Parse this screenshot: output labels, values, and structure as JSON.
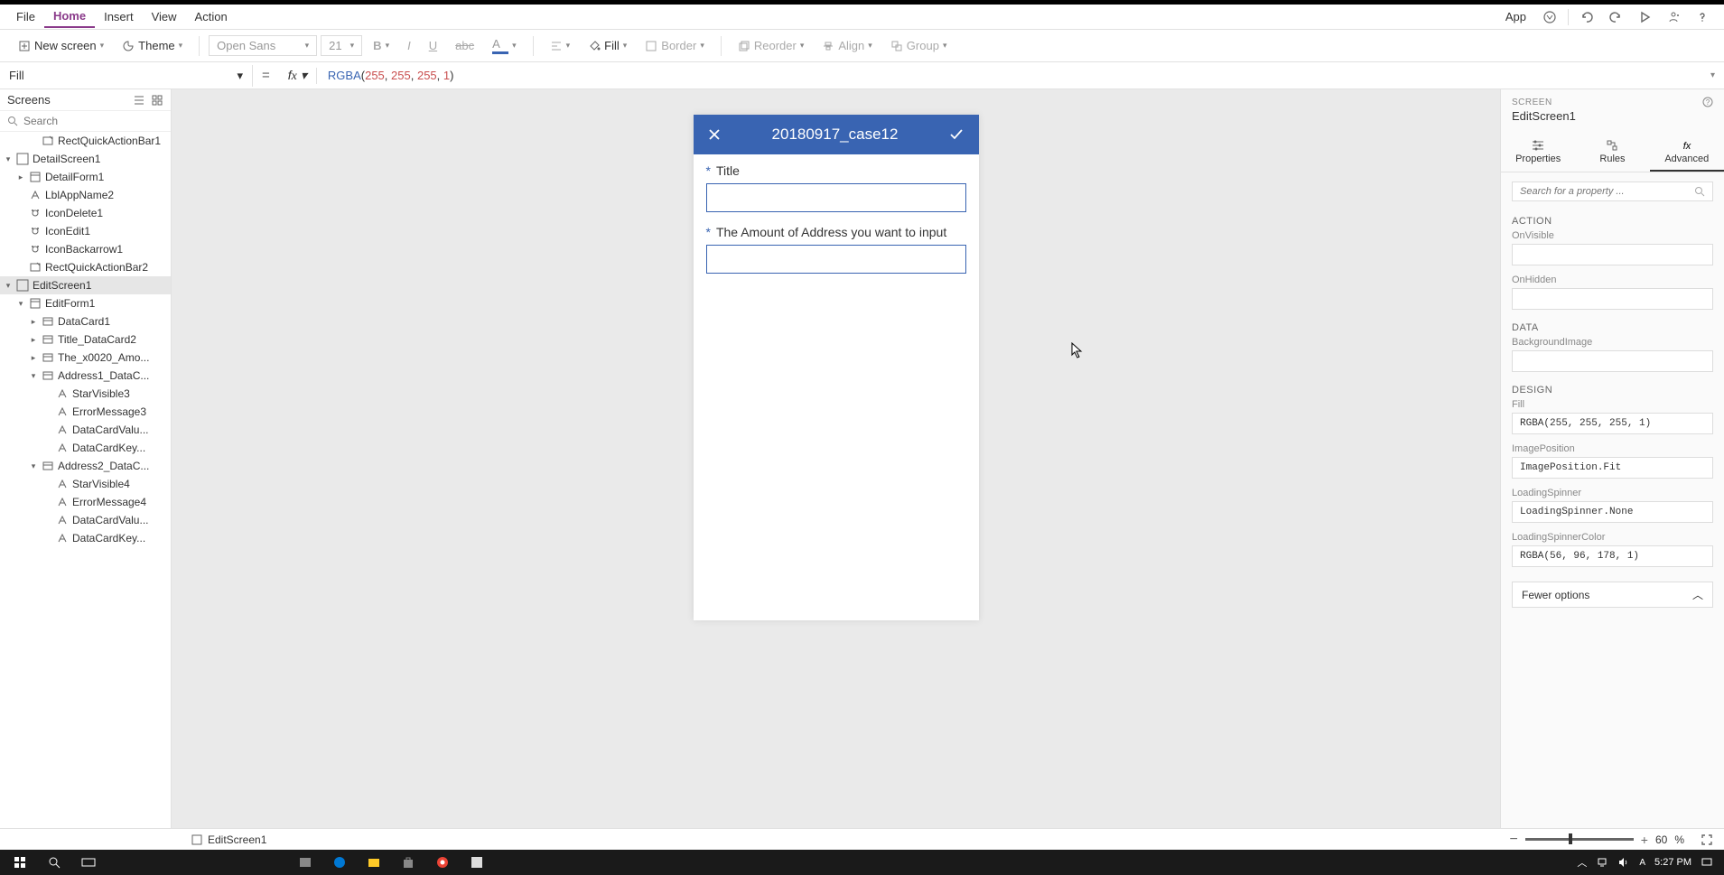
{
  "menubar": {
    "items": [
      "File",
      "Home",
      "Insert",
      "View",
      "Action"
    ],
    "active_index": 1,
    "app_label": "App"
  },
  "toolbar": {
    "new_screen": "New screen",
    "theme": "Theme",
    "font_family": "Open Sans",
    "font_size": "21",
    "fill": "Fill",
    "border": "Border",
    "reorder": "Reorder",
    "align": "Align",
    "group": "Group"
  },
  "propertybar": {
    "selector": "Fill",
    "formula_fn": "RGBA",
    "formula_args": "(255, 255, 255, 1)"
  },
  "tree": {
    "title": "Screens",
    "search_placeholder": "Search",
    "items": [
      {
        "label": "RectQuickActionBar1",
        "indent": 2,
        "icon": "rect-edit",
        "caret": ""
      },
      {
        "label": "DetailScreen1",
        "indent": 0,
        "icon": "screen",
        "caret": "▾"
      },
      {
        "label": "DetailForm1",
        "indent": 1,
        "icon": "form",
        "caret": "▸"
      },
      {
        "label": "LblAppName2",
        "indent": 1,
        "icon": "label",
        "caret": ""
      },
      {
        "label": "IconDelete1",
        "indent": 1,
        "icon": "icon-ctrl",
        "caret": ""
      },
      {
        "label": "IconEdit1",
        "indent": 1,
        "icon": "icon-ctrl",
        "caret": ""
      },
      {
        "label": "IconBackarrow1",
        "indent": 1,
        "icon": "icon-ctrl",
        "caret": ""
      },
      {
        "label": "RectQuickActionBar2",
        "indent": 1,
        "icon": "rect-edit",
        "caret": ""
      },
      {
        "label": "EditScreen1",
        "indent": 0,
        "icon": "screen",
        "caret": "▾",
        "selected": true
      },
      {
        "label": "EditForm1",
        "indent": 1,
        "icon": "form",
        "caret": "▾"
      },
      {
        "label": "DataCard1",
        "indent": 2,
        "icon": "card",
        "caret": "▸"
      },
      {
        "label": "Title_DataCard2",
        "indent": 2,
        "icon": "card",
        "caret": "▸"
      },
      {
        "label": "The_x0020_Amo...",
        "indent": 2,
        "icon": "card",
        "caret": "▸"
      },
      {
        "label": "Address1_DataC...",
        "indent": 2,
        "icon": "card",
        "caret": "▾"
      },
      {
        "label": "StarVisible3",
        "indent": 3,
        "icon": "label",
        "caret": ""
      },
      {
        "label": "ErrorMessage3",
        "indent": 3,
        "icon": "label",
        "caret": ""
      },
      {
        "label": "DataCardValu...",
        "indent": 3,
        "icon": "label",
        "caret": ""
      },
      {
        "label": "DataCardKey...",
        "indent": 3,
        "icon": "label",
        "caret": ""
      },
      {
        "label": "Address2_DataC...",
        "indent": 2,
        "icon": "card",
        "caret": "▾"
      },
      {
        "label": "StarVisible4",
        "indent": 3,
        "icon": "label",
        "caret": ""
      },
      {
        "label": "ErrorMessage4",
        "indent": 3,
        "icon": "label",
        "caret": ""
      },
      {
        "label": "DataCardValu...",
        "indent": 3,
        "icon": "label",
        "caret": ""
      },
      {
        "label": "DataCardKey...",
        "indent": 3,
        "icon": "label",
        "caret": ""
      }
    ]
  },
  "canvas": {
    "header_title": "20180917_case12",
    "fields": [
      {
        "label": "Title",
        "required": true
      },
      {
        "label": "The Amount of Address you want to input",
        "required": true
      }
    ]
  },
  "props": {
    "header_label": "SCREEN",
    "name": "EditScreen1",
    "tabs": [
      "Properties",
      "Rules",
      "Advanced"
    ],
    "active_tab": 2,
    "search_placeholder": "Search for a property ...",
    "sections": [
      {
        "title": "ACTION",
        "rows": [
          {
            "label": "OnVisible",
            "value": ""
          },
          {
            "label": "OnHidden",
            "value": ""
          }
        ]
      },
      {
        "title": "DATA",
        "rows": [
          {
            "label": "BackgroundImage",
            "value": ""
          }
        ]
      },
      {
        "title": "DESIGN",
        "rows": [
          {
            "label": "Fill",
            "value": "RGBA(255, 255, 255, 1)"
          },
          {
            "label": "ImagePosition",
            "value": "ImagePosition.Fit"
          },
          {
            "label": "LoadingSpinner",
            "value": "LoadingSpinner.None"
          },
          {
            "label": "LoadingSpinnerColor",
            "value": "RGBA(56, 96, 178, 1)"
          }
        ]
      }
    ],
    "footer": "Fewer options"
  },
  "bottombar": {
    "breadcrumb": "EditScreen1",
    "zoom_value": "60",
    "zoom_unit": "%"
  },
  "taskbar": {
    "time": "5:27 PM"
  }
}
